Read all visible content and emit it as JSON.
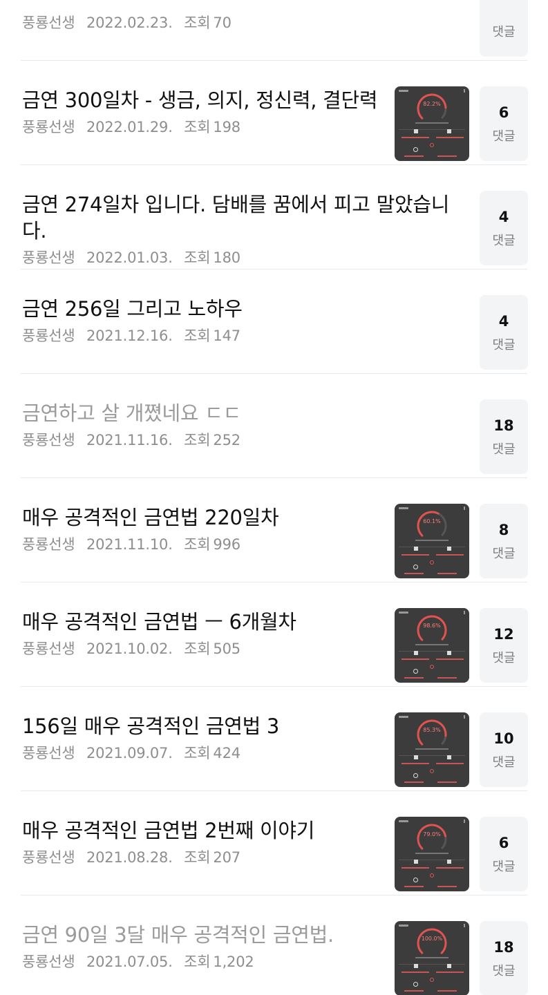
{
  "posts": [
    {
      "title": "",
      "author": "풍룡선생",
      "date": "2022.02.23.",
      "views_label": "조회",
      "views": "70",
      "comments": "",
      "comments_label": "댓글",
      "thumbnail": false,
      "read": false,
      "gauge_pct": ""
    },
    {
      "title": "금연 300일차 - 생금, 의지, 정신력, 결단력",
      "author": "풍룡선생",
      "date": "2022.01.29.",
      "views_label": "조회",
      "views": "198",
      "comments": "6",
      "comments_label": "댓글",
      "thumbnail": true,
      "read": false,
      "gauge_pct": "82.2%"
    },
    {
      "title": "금연 274일차 입니다. 담배를 꿈에서 피고 말았습니다.",
      "author": "풍룡선생",
      "date": "2022.01.03.",
      "views_label": "조회",
      "views": "180",
      "comments": "4",
      "comments_label": "댓글",
      "thumbnail": false,
      "read": false,
      "gauge_pct": ""
    },
    {
      "title": "금연 256일 그리고 노하우",
      "author": "풍룡선생",
      "date": "2021.12.16.",
      "views_label": "조회",
      "views": "147",
      "comments": "4",
      "comments_label": "댓글",
      "thumbnail": false,
      "read": false,
      "gauge_pct": ""
    },
    {
      "title": "금연하고 살 개쪘네요 ㄷㄷ",
      "author": "풍룡선생",
      "date": "2021.11.16.",
      "views_label": "조회",
      "views": "252",
      "comments": "18",
      "comments_label": "댓글",
      "thumbnail": false,
      "read": true,
      "gauge_pct": ""
    },
    {
      "title": "매우 공격적인 금연법 220일차",
      "author": "풍룡선생",
      "date": "2021.11.10.",
      "views_label": "조회",
      "views": "996",
      "comments": "8",
      "comments_label": "댓글",
      "thumbnail": true,
      "read": false,
      "gauge_pct": "60.1%"
    },
    {
      "title": "매우 공격적인 금연법 ㅡ 6개월차",
      "author": "풍룡선생",
      "date": "2021.10.02.",
      "views_label": "조회",
      "views": "505",
      "comments": "12",
      "comments_label": "댓글",
      "thumbnail": true,
      "read": false,
      "gauge_pct": "98.6%"
    },
    {
      "title": "156일 매우 공격적인 금연법 3",
      "author": "풍룡선생",
      "date": "2021.09.07.",
      "views_label": "조회",
      "views": "424",
      "comments": "10",
      "comments_label": "댓글",
      "thumbnail": true,
      "read": false,
      "gauge_pct": "85.3%"
    },
    {
      "title": "매우 공격적인 금연법 2번째 이야기",
      "author": "풍룡선생",
      "date": "2021.08.28.",
      "views_label": "조회",
      "views": "207",
      "comments": "6",
      "comments_label": "댓글",
      "thumbnail": true,
      "read": false,
      "gauge_pct": "79.0%"
    },
    {
      "title": "금연 90일 3달 매우 공격적인 금연법.",
      "author": "풍룡선생",
      "date": "2021.07.05.",
      "views_label": "조회",
      "views": "1,202",
      "comments": "18",
      "comments_label": "댓글",
      "thumbnail": true,
      "read": true,
      "gauge_pct": "100.0%"
    }
  ],
  "colors": {
    "title": "#111111",
    "title_read": "#9b9b9b",
    "meta": "#8e8e8e",
    "count_bg": "#f3f4f6",
    "gauge": "#e2524f"
  }
}
